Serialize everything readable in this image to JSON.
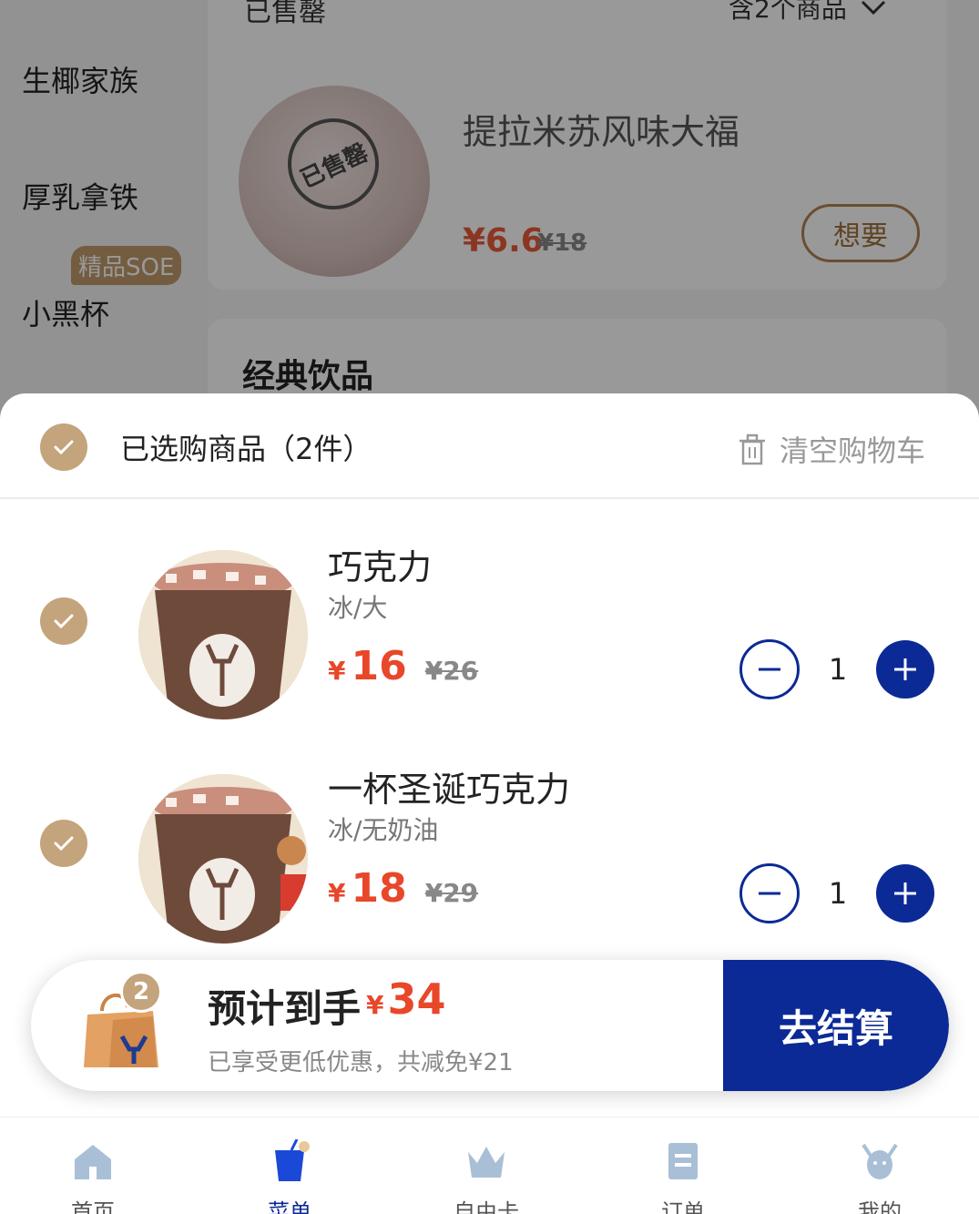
{
  "background": {
    "categories": [
      "生椰家族",
      "厚乳拿铁",
      "小黑杯"
    ],
    "soe_badge": "精品SOE",
    "sold_section": {
      "header": "已售罄",
      "count_label": "含2个商品",
      "product_name": "提拉米苏风味大福",
      "stamp_text": "已售罄",
      "price": "¥6.6",
      "original_price": "¥18",
      "want_button": "想要"
    },
    "classic_title": "经典饮品"
  },
  "cart": {
    "title": "已选购商品（2件）",
    "clear_label": "清空购物车",
    "items": [
      {
        "name": "巧克力",
        "spec": "冰/大",
        "price_symbol": "¥",
        "price": "16",
        "original_price": "¥26",
        "quantity": "1"
      },
      {
        "name": "一杯圣诞巧克力",
        "spec": "冰/无奶油",
        "price_symbol": "¥",
        "price": "18",
        "original_price": "¥29",
        "quantity": "1"
      }
    ]
  },
  "checkout": {
    "badge_count": "2",
    "estimate_label": "预计到手",
    "currency": "¥",
    "estimate_amount": "34",
    "discount_note": "已享受更低优惠，共减免¥21",
    "pay_button": "去结算"
  },
  "tabs": [
    {
      "label": "首页",
      "icon": "home-icon"
    },
    {
      "label": "菜单",
      "icon": "menu-cup-icon"
    },
    {
      "label": "自由卡",
      "icon": "crown-icon"
    },
    {
      "label": "订单",
      "icon": "order-icon"
    },
    {
      "label": "我的",
      "icon": "deer-icon"
    }
  ],
  "colors": {
    "brand_blue": "#0b2a96",
    "price_red": "#e8472a",
    "check_gold": "#c4a47c"
  }
}
